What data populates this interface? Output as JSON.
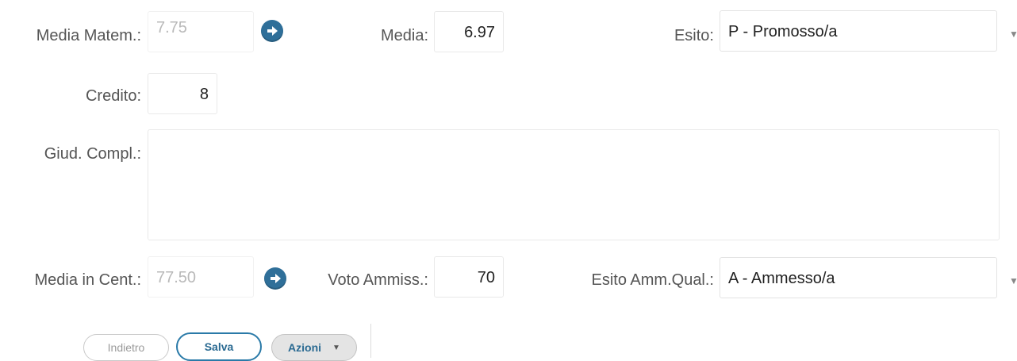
{
  "row1": {
    "media_matem_label": "Media Matem.:",
    "media_matem_value": "7.75",
    "media_label": "Media:",
    "media_value": "6.97",
    "esito_label": "Esito:",
    "esito_value": "P - Promosso/a"
  },
  "row2": {
    "credito_label": "Credito:",
    "credito_value": "8"
  },
  "row3": {
    "giud_label": "Giud. Compl.:",
    "giud_value": ""
  },
  "row4": {
    "media_cent_label": "Media in Cent.:",
    "media_cent_value": "77.50",
    "voto_label": "Voto Ammiss.:",
    "voto_value": "70",
    "esito_amm_label": "Esito Amm.Qual.:",
    "esito_amm_value": "A - Ammesso/a"
  },
  "buttons": {
    "back_label": "Indietro",
    "save_label": "Salva",
    "actions_label": "Azioni"
  },
  "icons": {
    "arrow": "arrow-right-circle-icon",
    "dropdown": "caret-down-icon"
  },
  "colors": {
    "accent": "#2f6f99",
    "label": "#555555",
    "disabled": "#b9b9b9"
  }
}
